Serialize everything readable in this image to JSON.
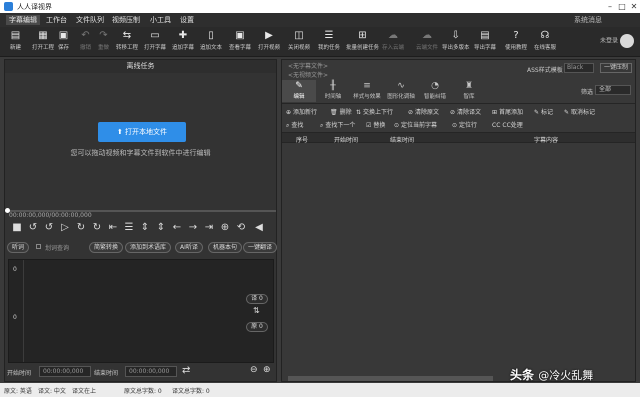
{
  "window": {
    "title": "人人译视界"
  },
  "menu": {
    "items": [
      "字幕编辑",
      "工作台",
      "文件队列",
      "视频压制",
      "小工具",
      "设置"
    ],
    "system_message": "系统消息"
  },
  "toolbar": {
    "items": [
      {
        "label": "新建",
        "icon": "new-icon",
        "glyph": "▤"
      },
      {
        "label": "打开工程",
        "icon": "open-project-icon",
        "glyph": "▦"
      },
      {
        "label": "保存",
        "icon": "save-icon",
        "glyph": "▣"
      },
      {
        "label": "撤销",
        "icon": "undo-icon",
        "glyph": "↶"
      },
      {
        "label": "重做",
        "icon": "redo-icon",
        "glyph": "↷"
      },
      {
        "label": "转移工程",
        "icon": "transfer-icon",
        "glyph": "⇆"
      },
      {
        "label": "打开字幕",
        "icon": "open-subtitle-icon",
        "glyph": "▭"
      },
      {
        "label": "追加字幕",
        "icon": "append-subtitle-icon",
        "glyph": "✚"
      },
      {
        "label": "追加文本",
        "icon": "append-text-icon",
        "glyph": "▯"
      },
      {
        "label": "查看字幕",
        "icon": "view-subtitle-icon",
        "glyph": "▣"
      },
      {
        "label": "打开视频",
        "icon": "open-video-icon",
        "glyph": "▶"
      },
      {
        "label": "关闭视频",
        "icon": "close-video-icon",
        "glyph": "◫"
      },
      {
        "label": "我的任务",
        "icon": "my-tasks-icon",
        "glyph": "☰"
      },
      {
        "label": "批量创建任务",
        "icon": "batch-task-icon",
        "glyph": "⊞"
      },
      {
        "label": "存入云端",
        "icon": "cloud-save-icon",
        "glyph": "☁"
      },
      {
        "label": "云端文件",
        "icon": "cloud-files-icon",
        "glyph": "☁"
      },
      {
        "label": "导出多版本",
        "icon": "export-multi-icon",
        "glyph": "⇩"
      },
      {
        "label": "导出字幕",
        "icon": "export-subtitle-icon",
        "glyph": "▤"
      },
      {
        "label": "使用教程",
        "icon": "tutorial-icon",
        "glyph": "?"
      },
      {
        "label": "在线客服",
        "icon": "support-icon",
        "glyph": "☊"
      }
    ],
    "login": "未登录"
  },
  "left_panel": {
    "header": "离线任务",
    "open_button": "打开本地文件",
    "hint": "您可以拖动视频和字幕文件到软件中进行编辑",
    "timecode": "00:00:00,000/00:00:00,000",
    "buttons": {
      "listen": "听词",
      "auto_listen": "划词查询",
      "convert": "简繁转换",
      "add_term": "添加到术语库",
      "ai_listen": "AI听译",
      "machine_proofread": "机器本句",
      "one_click": "一键翻译"
    },
    "wave_zero_top": "0",
    "wave_zero_bottom": "0",
    "count_top": "译 0",
    "count_bottom": "原 0",
    "start_label": "开始时间",
    "start_value": "00:00:00,000",
    "end_label": "结束时间",
    "end_value": "00:00:00,000"
  },
  "right_panel": {
    "no_subtitle": "<无字幕文件>",
    "no_video": "<无视频文件>",
    "ass_label": "ASS样式模板",
    "ass_value": "Black",
    "one_key": "一键压制",
    "tabs": [
      {
        "label": "编辑",
        "icon": "edit-icon",
        "glyph": "✎"
      },
      {
        "label": "时间轴",
        "icon": "timeline-icon",
        "glyph": "╫"
      },
      {
        "label": "样式与效果",
        "icon": "style-icon",
        "glyph": "≡"
      },
      {
        "label": "图形化调轴",
        "icon": "graph-icon",
        "glyph": "∿"
      },
      {
        "label": "智能纠错",
        "icon": "smart-fix-icon",
        "glyph": "◔"
      },
      {
        "label": "智库",
        "icon": "library-icon",
        "glyph": "♜"
      }
    ],
    "filter_label": "筛选",
    "filter_value": "全部",
    "actions_row1": [
      "添加新行",
      "删除",
      "交换上下行",
      "清除原文",
      "清除译文",
      "首尾添加",
      "标记",
      "取消标记"
    ],
    "actions_row2": [
      "查找",
      "查找下一个",
      "替换",
      "定位当前字幕",
      "定位行",
      "CC处理"
    ],
    "columns": [
      "序号",
      "开始时间",
      "结束时间",
      "字幕内容"
    ]
  },
  "status": {
    "src_lang": "原文: 英语",
    "tgt_lang": "译文: 中文",
    "pos": "译文在上",
    "src_count": "原文总字数: 0",
    "tgt_count": "译文总字数: 0"
  },
  "watermark": {
    "prefix": "头条",
    "handle": "@冷火乱舞"
  }
}
